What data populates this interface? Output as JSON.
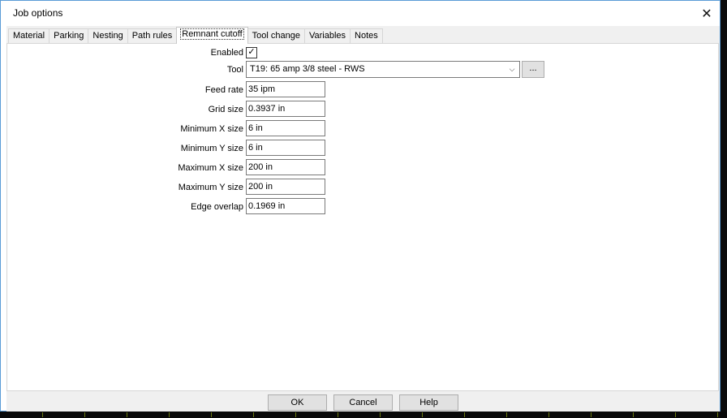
{
  "window": {
    "title": "Job options",
    "close_glyph": "✕"
  },
  "tabs": [
    {
      "label": "Material"
    },
    {
      "label": "Parking"
    },
    {
      "label": "Nesting"
    },
    {
      "label": "Path rules"
    },
    {
      "label": "Remnant cutoff",
      "active": true
    },
    {
      "label": "Tool change"
    },
    {
      "label": "Variables"
    },
    {
      "label": "Notes"
    }
  ],
  "form": {
    "enabled": {
      "label": "Enabled",
      "checked": true,
      "mark": "✓"
    },
    "tool": {
      "label": "Tool",
      "value": "T19: 65 amp 3/8 steel - RWS",
      "arrow": "⌵",
      "browse_label": "..."
    },
    "feed_rate": {
      "label": "Feed rate",
      "value": "35 ipm"
    },
    "grid_size": {
      "label": "Grid size",
      "value": "0.3937 in"
    },
    "min_x": {
      "label": "Minimum X size",
      "value": "6 in"
    },
    "min_y": {
      "label": "Minimum Y size",
      "value": "6 in"
    },
    "max_x": {
      "label": "Maximum X size",
      "value": "200 in"
    },
    "max_y": {
      "label": "Maximum Y size",
      "value": "200 in"
    },
    "edge_overlap": {
      "label": "Edge overlap",
      "value": "0.1969 in"
    }
  },
  "footer": {
    "ok_label": "OK",
    "cancel_label": "Cancel",
    "help_label": "Help"
  }
}
